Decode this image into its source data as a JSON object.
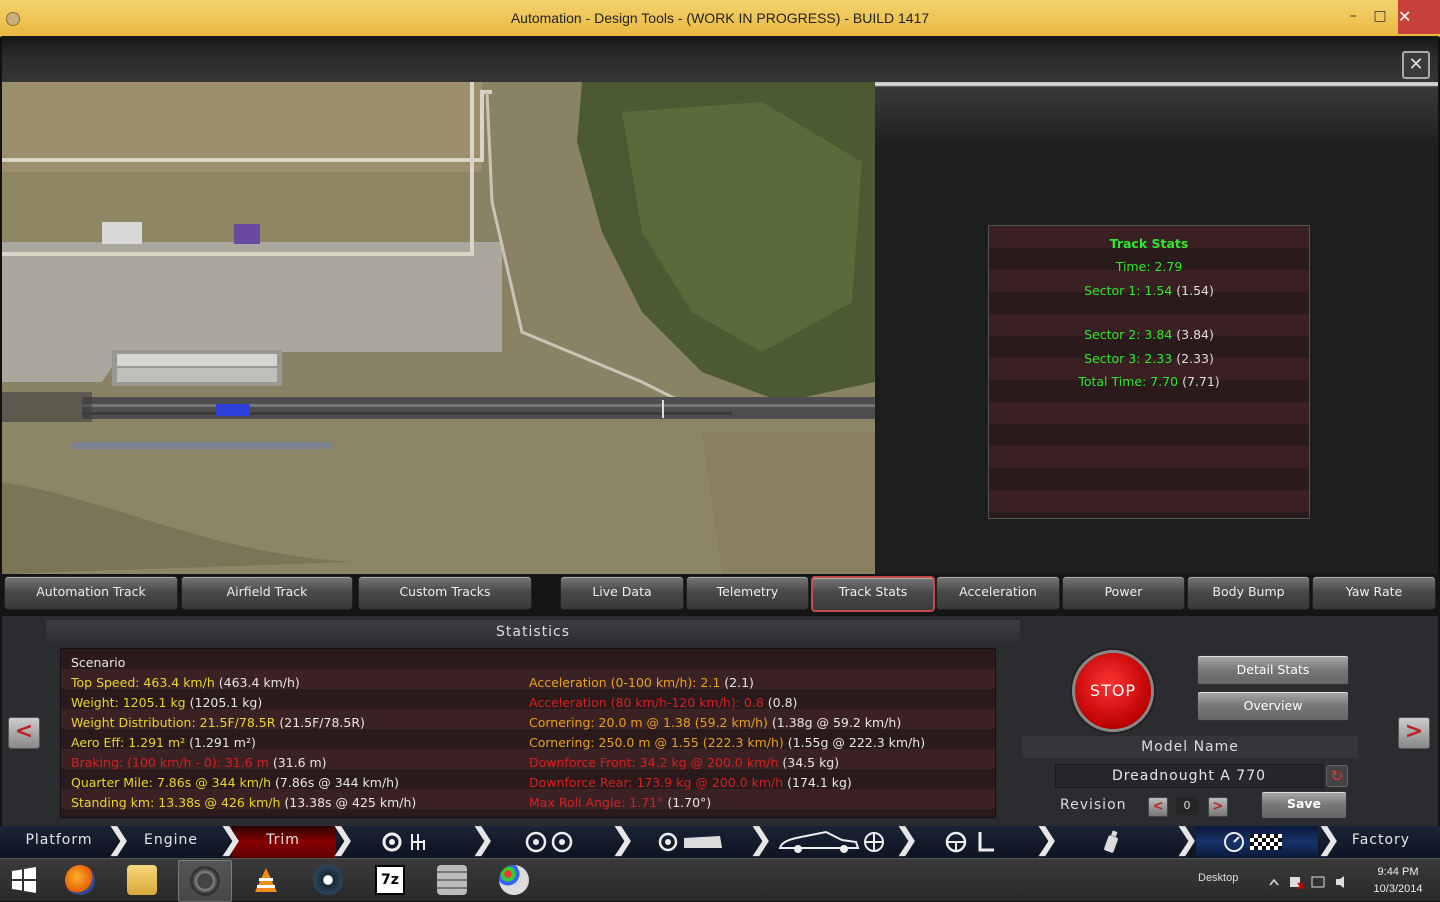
{
  "window": {
    "title": "Automation - Design Tools - (WORK IN PROGRESS) - BUILD 1417",
    "minimize_glyph": "–",
    "maximize_glyph": "□",
    "close_glyph": "✕"
  },
  "panel_close_glyph": "✕",
  "track_stats": {
    "title": "Track Stats",
    "time": "Time: 2.79",
    "sector1": "Sector 1: 1.54",
    "sector1_prev": "(1.54)",
    "sector2": "Sector 2: 3.84",
    "sector2_prev": "(3.84)",
    "sector3": "Sector 3: 2.33",
    "sector3_prev": "(2.33)",
    "total": "Total Time: 7.70",
    "total_prev": "(7.71)"
  },
  "track_tabs": [
    "Automation Track",
    "Airfield Track",
    "Custom Tracks"
  ],
  "data_tabs": [
    "Live Data",
    "Telemetry",
    "Track Stats",
    "Acceleration",
    "Power",
    "Body Bump",
    "Yaw Rate"
  ],
  "active_data_tab": "Track Stats",
  "statistics": {
    "header": "Statistics",
    "scenario_label": "Scenario",
    "left": [
      {
        "value": "Top Speed: 463.4 km/h",
        "prev": "(463.4 km/h)",
        "color": "#e8d52a"
      },
      {
        "value": "Weight: 1205.1 kg",
        "prev": "(1205.1 kg)",
        "color": "#e8d52a"
      },
      {
        "value": "Weight Distribution: 21.5F/78.5R",
        "prev": "(21.5F/78.5R)",
        "color": "#e8d52a"
      },
      {
        "value": "Aero Eff: 1.291 m²",
        "prev": "(1.291 m²)",
        "color": "#e8d52a"
      },
      {
        "value": "Braking: (100 km/h - 0): 31.6 m",
        "prev": "(31.6 m)",
        "color": "#d42020"
      },
      {
        "value": "Quarter Mile: 7.86s @ 344 km/h",
        "prev": "(7.86s @ 344 km/h)",
        "color": "#e8d52a"
      },
      {
        "value": "Standing km: 13.38s @ 426 km/h",
        "prev": "(13.38s @ 425 km/h)",
        "color": "#e8d52a"
      }
    ],
    "right": [
      {
        "value": "Acceleration (0-100 km/h): 2.1",
        "prev": "(2.1)",
        "color": "#e8a020"
      },
      {
        "value": "Acceleration (80 km/h-120 km/h): 0.8",
        "prev": "(0.8)",
        "color": "#d42020"
      },
      {
        "value": "Cornering: 20.0 m @ 1.38 (59.2 km/h)",
        "prev": "(1.38g @ 59.2 km/h)",
        "color": "#e8a020"
      },
      {
        "value": "Cornering: 250.0 m @ 1.55 (222.3 km/h)",
        "prev": "(1.55g @ 222.3 km/h)",
        "color": "#e8a020"
      },
      {
        "value": "Downforce Front: 34.2 kg @ 200.0 km/h",
        "prev": "(34.5 kg)",
        "color": "#d42020"
      },
      {
        "value": "Downforce Rear: 173.9 kg @ 200.0 km/h",
        "prev": "(174.1 kg)",
        "color": "#d42020"
      },
      {
        "value": "Max Roll Angle: 1.71°",
        "prev": "(1.70°)",
        "color": "#d42020"
      }
    ]
  },
  "controls": {
    "stop_label": "STOP",
    "detail_stats": "Detail Stats",
    "overview": "Overview",
    "model_name_label": "Model Name",
    "model_name_value": "Dreadnought A 770",
    "revision_label": "Revision",
    "revision_value": "0",
    "save": "Save",
    "prev_arrow": "<",
    "next_arrow": ">",
    "reload_glyph": "↻"
  },
  "nav": {
    "platform": "Platform",
    "engine": "Engine",
    "trim": "Trim",
    "factory": "Factory",
    "sep": "❯"
  },
  "taskbar": {
    "desktop": "Desktop",
    "time": "9:44 PM",
    "date": "10/3/2014",
    "apps": [
      "firefox-icon",
      "explorer-icon",
      "automation-icon",
      "vlc-icon",
      "steam-icon",
      "7zip-icon",
      "bricks-icon",
      "paint-icon"
    ],
    "active_app": "automation-icon"
  }
}
